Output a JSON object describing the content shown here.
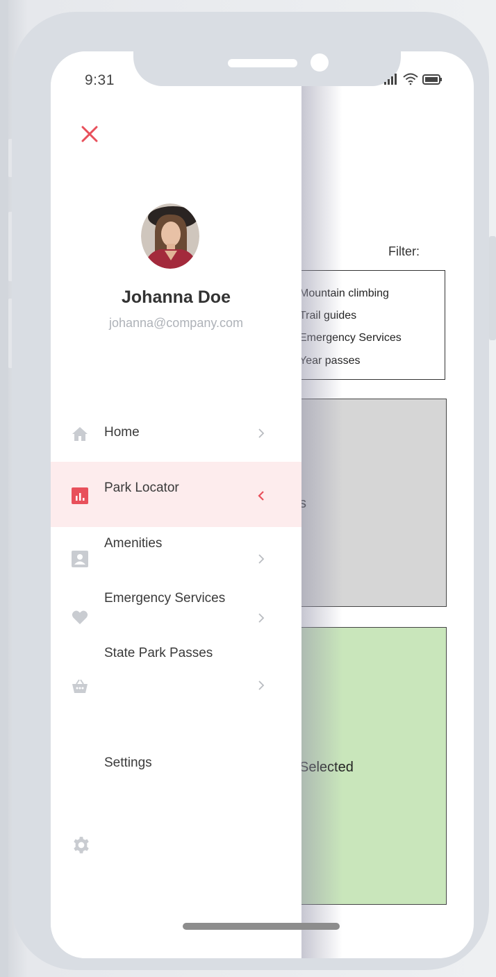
{
  "status_bar": {
    "time": "9:31"
  },
  "profile": {
    "name": "Johanna Doe",
    "email": "johanna@company.com"
  },
  "menu": {
    "items": [
      {
        "label": "Home",
        "icon": "home-icon",
        "active": false
      },
      {
        "label": "Park Locator",
        "icon": "bar-chart-icon",
        "active": true
      },
      {
        "label": "Amenities",
        "icon": "contact-card-icon",
        "active": false
      },
      {
        "label": "Emergency Services",
        "icon": "heart-icon",
        "active": false
      },
      {
        "label": "State Park Passes",
        "icon": "basket-icon",
        "active": false
      }
    ],
    "settings_label": "Settings"
  },
  "background": {
    "filter_label": "Filter:",
    "filter_options": [
      "Mountain climbing",
      "Trail guides",
      "Emergency Services",
      "Year passes"
    ],
    "gray_box_text": "s",
    "green_box_text": "Selected"
  },
  "colors": {
    "accent": "#e8505b",
    "active_bg": "#fdeced",
    "icon_gray": "#c9ccd1",
    "frame": "#d9dde3",
    "gray_box": "#d6d6d6",
    "green_box": "#c9e6bb"
  }
}
